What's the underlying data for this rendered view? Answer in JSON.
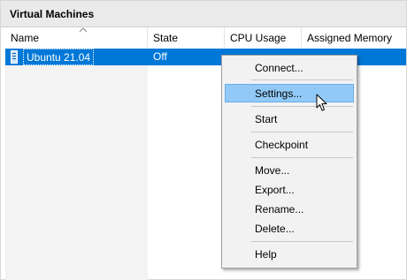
{
  "panel": {
    "title": "Virtual Machines"
  },
  "columns": {
    "name": "Name",
    "state": "State",
    "cpu": "CPU Usage",
    "memory": "Assigned Memory"
  },
  "vms": [
    {
      "name": "Ubuntu 21.04",
      "state": "Off"
    }
  ],
  "context_menu": {
    "items": [
      {
        "label": "Connect..."
      },
      {
        "label": "Settings...",
        "highlighted": true
      },
      {
        "label": "Start"
      },
      {
        "label": "Checkpoint"
      },
      {
        "label": "Move..."
      },
      {
        "label": "Export..."
      },
      {
        "label": "Rename..."
      },
      {
        "label": "Delete..."
      },
      {
        "label": "Help"
      }
    ]
  },
  "colors": {
    "selection": "#0078d7",
    "menu_highlight": "#91c9f7",
    "header_bg": "#eaeaea"
  },
  "icons": {
    "vm": "vm-icon",
    "sort": "sort-ascending-icon",
    "cursor": "mouse-pointer-icon"
  }
}
